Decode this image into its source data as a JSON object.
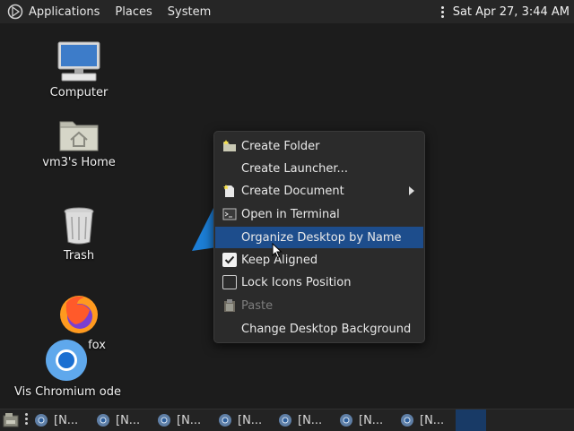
{
  "top_panel": {
    "menu": [
      "Applications",
      "Places",
      "System"
    ],
    "clock": "Sat Apr 27,  3:44 AM"
  },
  "desktop_icons": [
    {
      "label": "Computer",
      "icon": "computer-icon"
    },
    {
      "label": "vm3's Home",
      "icon": "home-folder-icon"
    },
    {
      "label": "Trash",
      "icon": "trash-icon"
    },
    {
      "label": "fox",
      "icon": "firefox-icon"
    },
    {
      "label": "Vis Chromium ode",
      "icon": "chromium-icon"
    }
  ],
  "context_menu": {
    "items": [
      {
        "label": "Create Folder",
        "icon": "folder-new-icon"
      },
      {
        "label": "Create Launcher...",
        "icon": ""
      },
      {
        "label": "Create Document",
        "icon": "document-new-icon",
        "submenu": true
      },
      {
        "label": "Open in Terminal",
        "icon": "terminal-icon"
      },
      {
        "label": "Organize Desktop by Name",
        "icon": "",
        "highlighted": true
      },
      {
        "label": "Keep Aligned",
        "checked": true
      },
      {
        "label": "Lock Icons Position",
        "checked": false
      },
      {
        "label": "Paste",
        "icon": "paste-icon",
        "disabled": true
      },
      {
        "label": "Change Desktop Background",
        "icon": ""
      }
    ]
  },
  "taskbar": {
    "windows": [
      "[N...",
      "[N...",
      "[N...",
      "[N...",
      "[N...",
      "[N...",
      "[N..."
    ]
  },
  "colors": {
    "menu_highlight": "#1d4d8c",
    "taskbar_active": "#183a66",
    "desktop_background": "#1c1c1c"
  }
}
